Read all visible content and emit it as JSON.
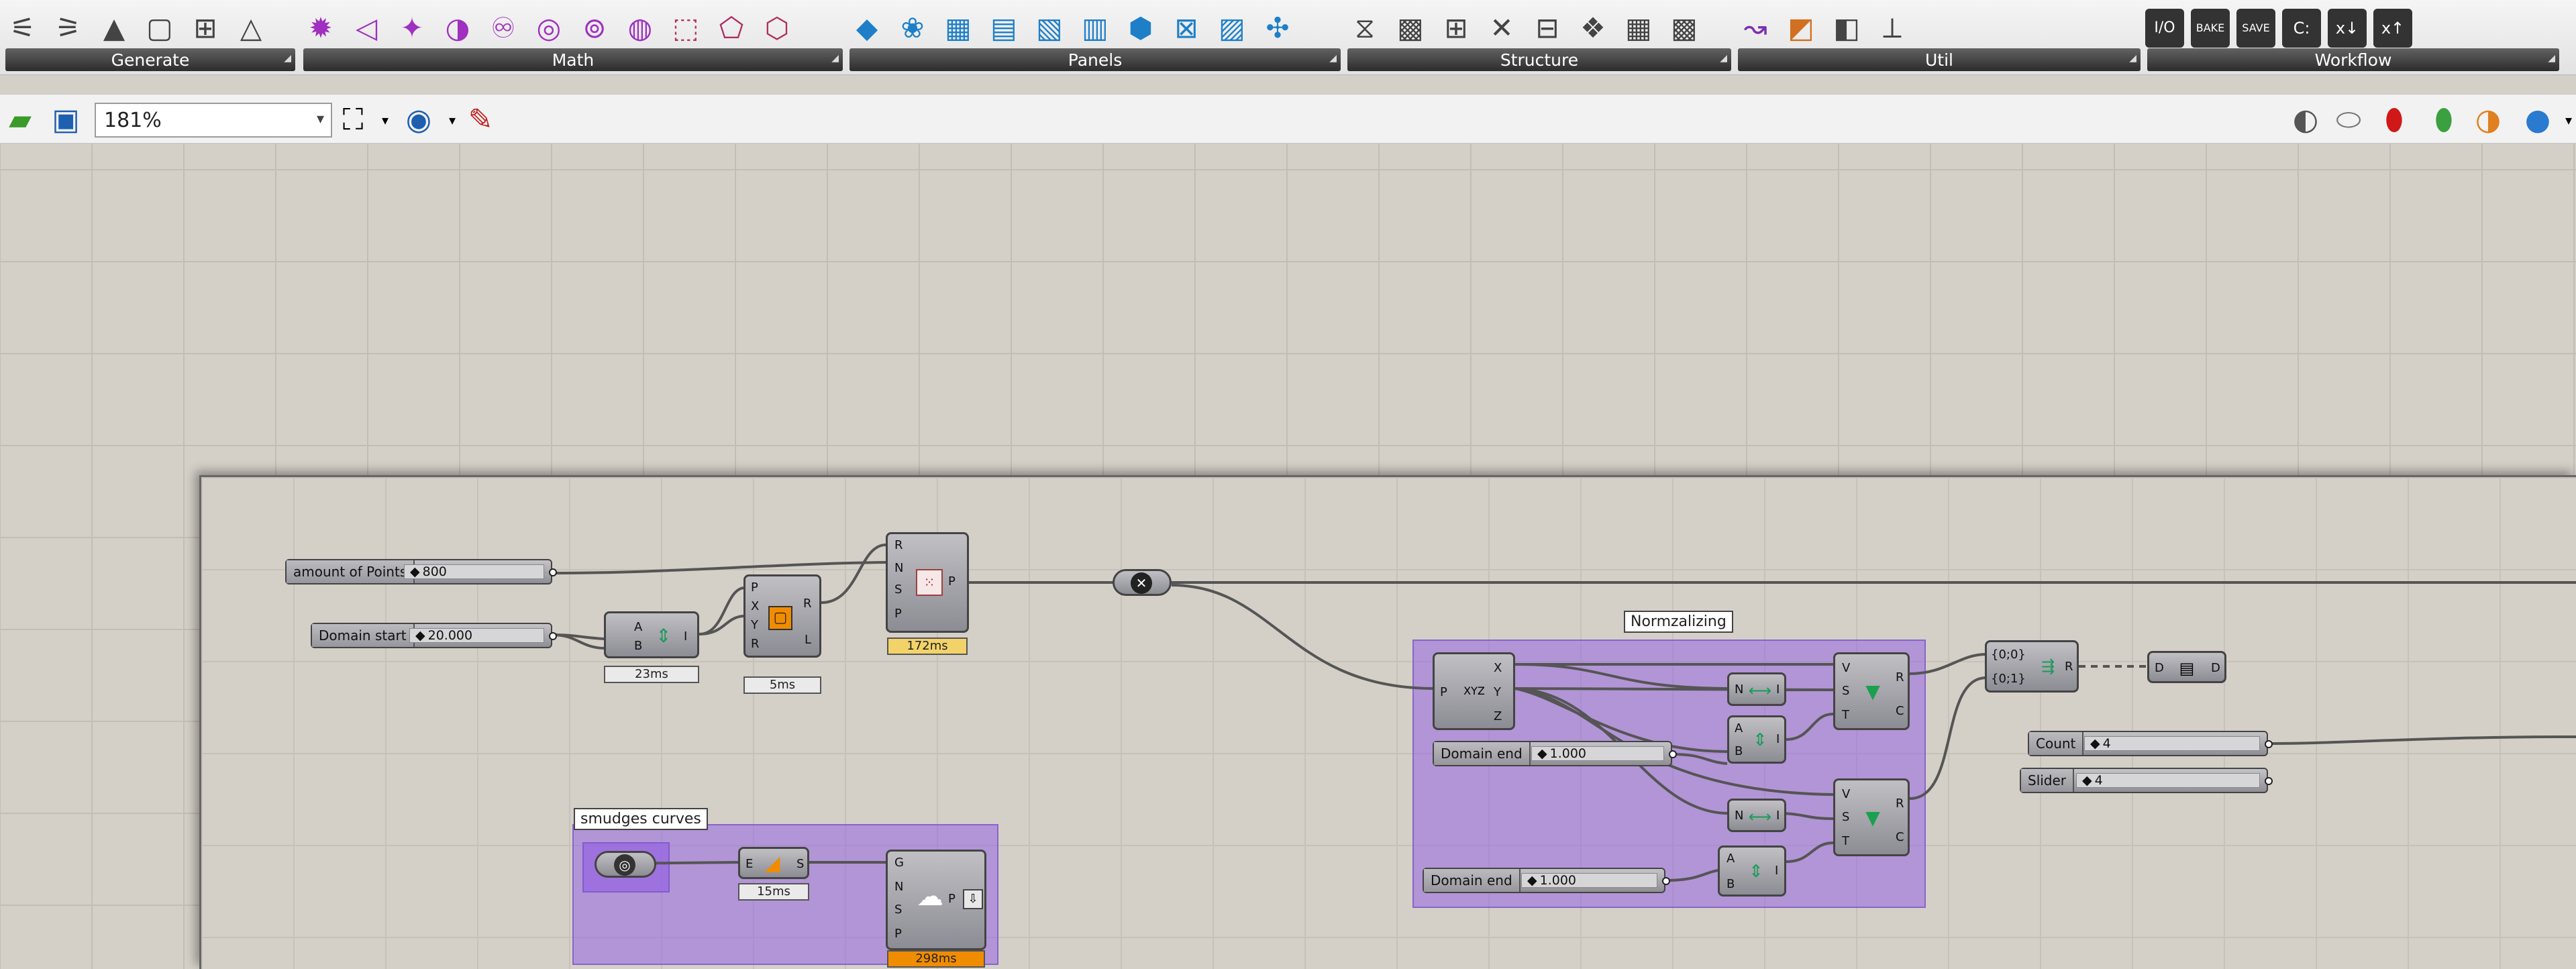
{
  "ribbon": {
    "tabs": [
      {
        "label": "Generate",
        "icons": [
          "⚟",
          "⚞",
          "▲",
          "▢",
          "⊞",
          "△"
        ]
      },
      {
        "label": "Math",
        "icons": [
          "✹",
          "◁",
          "✦",
          "◑",
          "♾",
          "◎",
          "⊚",
          "◍",
          "⬚",
          "⬠",
          "⬡"
        ]
      },
      {
        "label": "Panels",
        "icons": [
          "◆",
          "❀",
          "▦",
          "▤",
          "▧",
          "▥",
          "⬢",
          "⊠",
          "▨",
          "✣"
        ]
      },
      {
        "label": "Structure",
        "icons": [
          "⧖",
          "▩",
          "⊞",
          "✕",
          "⊟",
          "❖",
          "▦",
          "▩"
        ]
      },
      {
        "label": "Util",
        "icons": [
          "↝",
          "◩",
          "◧",
          "⟂"
        ]
      },
      {
        "label": "Workflow",
        "icons": [
          "⌘",
          "⬟",
          "◢",
          "I/O",
          "BAKE",
          "SAVE",
          "C:",
          "x↓",
          "x↑"
        ]
      }
    ]
  },
  "toolbar": {
    "zoom_value": "181%"
  },
  "canvas": {
    "sliders": [
      {
        "name": "amount of Points",
        "value": "800"
      },
      {
        "name": "Domain start",
        "value": "20.000"
      },
      {
        "name": "Domain end",
        "value": "1.000"
      },
      {
        "name": "Domain end",
        "value": "1.000"
      },
      {
        "name": "Count",
        "value": "4"
      },
      {
        "name": "Slider",
        "value": "4"
      }
    ],
    "groups": [
      {
        "label": "Normzalizing"
      },
      {
        "label": "smudges curves"
      }
    ],
    "timers": [
      "23ms",
      "5ms",
      "172ms",
      "15ms",
      "298ms"
    ],
    "paths": [
      "{0;0}",
      "{0;1}"
    ]
  },
  "colors": {
    "group_fill": "#9664e1",
    "timer_warn": "#f2d36a",
    "timer_slow": "#f08c00"
  }
}
